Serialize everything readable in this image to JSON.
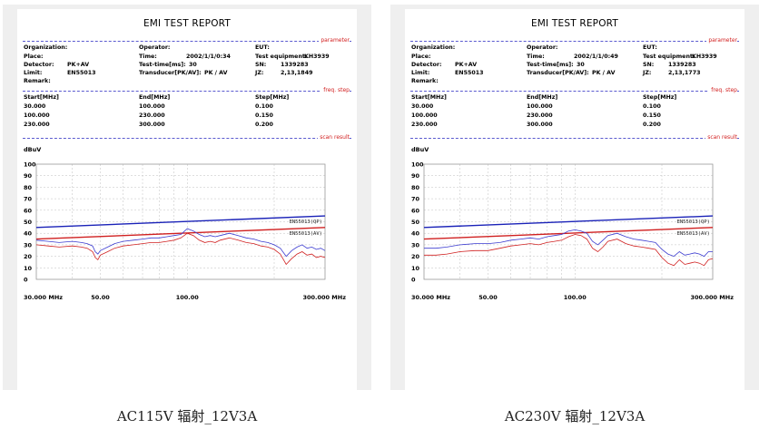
{
  "captions": [
    "AC115V 辐射_12V3A",
    "AC230V 辐射_12V3A"
  ],
  "reports": [
    {
      "title": "EMI TEST REPORT",
      "sections": {
        "parameter": "parameter",
        "freq": "freq. step",
        "scan": "scan result"
      },
      "params": {
        "organization_label": "Organization:",
        "operator_label": "Operator:",
        "eut_label": "EUT:",
        "place_label": "Place:",
        "time_label": "Time:",
        "time_value": "2002/1/1/0:34",
        "test_equipment_label": "Test equipment:",
        "test_equipment_value": "KH3939",
        "detector_label": "Detector:",
        "detector_value": "PK+AV",
        "test_time_label": "Test-time[ms]:",
        "test_time_value": "30",
        "sn_label": "SN:",
        "sn_value": "1339283",
        "limit_label": "Limit:",
        "limit_value": "EN55013",
        "transducer_label": "Transducer[PK/AV]:",
        "transducer_value": "PK  /  AV",
        "jz_label": "JZ:",
        "jz_value": "2,13,1849",
        "remark_label": "Remark:"
      },
      "freq_table": {
        "headers": [
          "Start[MHz]",
          "End[MHz]",
          "Step[MHz]"
        ],
        "rows": [
          [
            "30.000",
            "100.000",
            "0.100"
          ],
          [
            "100.000",
            "230.000",
            "0.150"
          ],
          [
            "230.000",
            "300.000",
            "0.200"
          ]
        ]
      },
      "chart_data": {
        "type": "line",
        "ylabel": "dBuV",
        "yticks": [
          "100",
          "90",
          "80",
          "70",
          "60",
          "50",
          "40",
          "30",
          "20",
          "10",
          "0"
        ],
        "ylim": [
          0,
          100
        ],
        "xlim": [
          30,
          300
        ],
        "x_scale": "log",
        "xticks": [
          {
            "x": 30,
            "label": "30.000 MHz"
          },
          {
            "x": 50,
            "label": "50.00"
          },
          {
            "x": 100,
            "label": "100.00"
          },
          {
            "x": 300,
            "label": "300.000 MHz"
          }
        ],
        "series": [
          {
            "name": "EN55013(QP)",
            "color": "#1a22b8",
            "x": [
              30,
              300
            ],
            "y": [
              45,
              55
            ]
          },
          {
            "name": "EN55013(AV)",
            "color": "#d02020",
            "x": [
              30,
              300
            ],
            "y": [
              35,
              45
            ]
          },
          {
            "name": "",
            "color": "#3b3bd0",
            "x": [
              30,
              33,
              36,
              40,
              43,
              45,
              47,
              48,
              49,
              50,
              53,
              56,
              60,
              65,
              70,
              75,
              80,
              85,
              90,
              95,
              100,
              105,
              110,
              115,
              120,
              125,
              130,
              140,
              150,
              160,
              170,
              180,
              190,
              200,
              210,
              220,
              230,
              240,
              250,
              260,
              270,
              280,
              290,
              300
            ],
            "y": [
              34,
              33,
              32,
              33,
              32,
              31,
              29,
              24,
              22,
              25,
              28,
              31,
              33,
              34,
              35,
              36,
              36,
              37,
              38,
              39,
              44,
              42,
              39,
              37,
              38,
              37,
              38,
              40,
              38,
              36,
              35,
              33,
              32,
              30,
              27,
              20,
              25,
              28,
              30,
              27,
              28,
              26,
              27,
              25
            ]
          },
          {
            "name": "",
            "color": "#d02020",
            "x": [
              30,
              33,
              36,
              40,
              43,
              45,
              47,
              48,
              49,
              50,
              53,
              56,
              60,
              65,
              70,
              75,
              80,
              85,
              90,
              95,
              100,
              105,
              110,
              115,
              120,
              125,
              130,
              140,
              150,
              160,
              170,
              180,
              190,
              200,
              210,
              220,
              230,
              240,
              250,
              260,
              270,
              280,
              290,
              300
            ],
            "y": [
              30,
              29,
              28,
              29,
              28,
              27,
              24,
              19,
              17,
              21,
              24,
              27,
              29,
              30,
              31,
              32,
              32,
              33,
              34,
              36,
              40,
              38,
              34,
              32,
              33,
              32,
              34,
              36,
              34,
              32,
              31,
              29,
              28,
              26,
              22,
              13,
              18,
              22,
              24,
              21,
              22,
              19,
              20,
              19
            ]
          }
        ]
      }
    },
    {
      "title": "EMI TEST REPORT",
      "sections": {
        "parameter": "parameter",
        "freq": "freq. step",
        "scan": "scan result"
      },
      "params": {
        "organization_label": "Organization:",
        "operator_label": "Operator:",
        "eut_label": "EUT:",
        "place_label": "Place:",
        "time_label": "Time:",
        "time_value": "2002/1/1/0:49",
        "test_equipment_label": "Test equipment:",
        "test_equipment_value": "KH3939",
        "detector_label": "Detector:",
        "detector_value": "PK+AV",
        "test_time_label": "Test-time[ms]:",
        "test_time_value": "30",
        "sn_label": "SN:",
        "sn_value": "1339283",
        "limit_label": "Limit:",
        "limit_value": "EN55013",
        "transducer_label": "Transducer[PK/AV]:",
        "transducer_value": "PK  /  AV",
        "jz_label": "JZ:",
        "jz_value": "2,13,1773",
        "remark_label": "Remark:"
      },
      "freq_table": {
        "headers": [
          "Start[MHz]",
          "End[MHz]",
          "Step[MHz]"
        ],
        "rows": [
          [
            "30.000",
            "100.000",
            "0.100"
          ],
          [
            "100.000",
            "230.000",
            "0.150"
          ],
          [
            "230.000",
            "300.000",
            "0.200"
          ]
        ]
      },
      "chart_data": {
        "type": "line",
        "ylabel": "dBuV",
        "yticks": [
          "100",
          "90",
          "80",
          "70",
          "60",
          "50",
          "40",
          "30",
          "20",
          "10",
          "0"
        ],
        "ylim": [
          0,
          100
        ],
        "xlim": [
          30,
          300
        ],
        "x_scale": "log",
        "xticks": [
          {
            "x": 30,
            "label": "30.000 MHz"
          },
          {
            "x": 50,
            "label": "50.00"
          },
          {
            "x": 100,
            "label": "100.00"
          },
          {
            "x": 300,
            "label": "300.000 MHz"
          }
        ],
        "series": [
          {
            "name": "EN55013(QP)",
            "color": "#1a22b8",
            "x": [
              30,
              300
            ],
            "y": [
              45,
              55
            ]
          },
          {
            "name": "EN55013(AV)",
            "color": "#d02020",
            "x": [
              30,
              300
            ],
            "y": [
              35,
              45
            ]
          },
          {
            "name": "",
            "color": "#3b3bd0",
            "x": [
              30,
              33,
              36,
              40,
              45,
              50,
              55,
              60,
              65,
              70,
              75,
              80,
              85,
              90,
              95,
              100,
              105,
              110,
              115,
              120,
              125,
              130,
              140,
              150,
              160,
              170,
              180,
              190,
              200,
              210,
              220,
              230,
              240,
              250,
              260,
              270,
              280,
              290,
              300
            ],
            "y": [
              27,
              27,
              28,
              30,
              31,
              31,
              32,
              34,
              35,
              36,
              35,
              37,
              38,
              39,
              42,
              43,
              42,
              40,
              33,
              30,
              34,
              38,
              40,
              37,
              35,
              34,
              33,
              32,
              26,
              22,
              20,
              24,
              21,
              22,
              23,
              22,
              20,
              24,
              24
            ]
          },
          {
            "name": "",
            "color": "#d02020",
            "x": [
              30,
              33,
              36,
              40,
              45,
              50,
              55,
              60,
              65,
              70,
              75,
              80,
              85,
              90,
              95,
              100,
              105,
              110,
              115,
              120,
              125,
              130,
              140,
              150,
              160,
              170,
              180,
              190,
              200,
              210,
              220,
              230,
              240,
              250,
              260,
              270,
              280,
              290,
              300
            ],
            "y": [
              21,
              21,
              22,
              24,
              25,
              25,
              27,
              29,
              30,
              31,
              30,
              32,
              33,
              34,
              37,
              39,
              38,
              35,
              27,
              24,
              28,
              33,
              35,
              31,
              29,
              28,
              27,
              26,
              19,
              14,
              12,
              17,
              13,
              14,
              15,
              14,
              12,
              17,
              18
            ]
          }
        ]
      }
    }
  ]
}
